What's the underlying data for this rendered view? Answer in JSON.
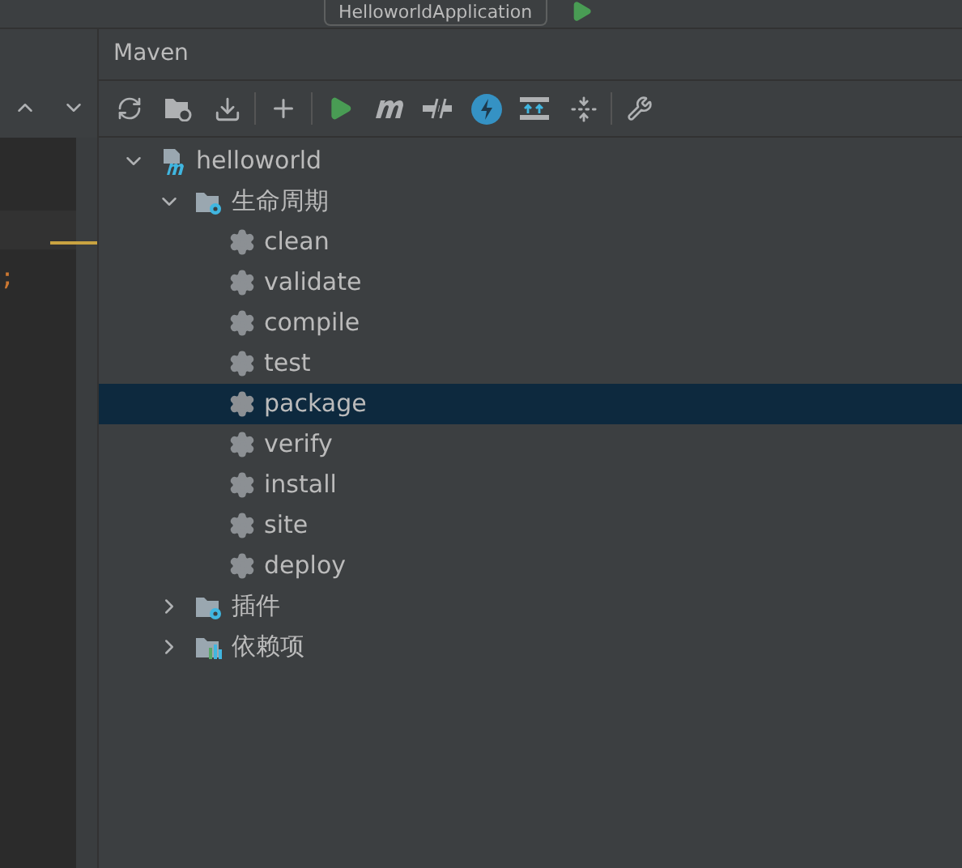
{
  "run_config": {
    "label": "HelloworldApplication"
  },
  "editor": {
    "code_fragment": ";"
  },
  "panel": {
    "title": "Maven"
  },
  "tree": [
    {
      "kind": "project",
      "label": "helloworld",
      "expanded": true,
      "selected": false,
      "children": [
        {
          "kind": "lifecycle",
          "label": "生命周期",
          "expanded": true,
          "selected": false,
          "children": [
            {
              "kind": "goal",
              "label": "clean",
              "selected": false
            },
            {
              "kind": "goal",
              "label": "validate",
              "selected": false
            },
            {
              "kind": "goal",
              "label": "compile",
              "selected": false
            },
            {
              "kind": "goal",
              "label": "test",
              "selected": false
            },
            {
              "kind": "goal",
              "label": "package",
              "selected": true
            },
            {
              "kind": "goal",
              "label": "verify",
              "selected": false
            },
            {
              "kind": "goal",
              "label": "install",
              "selected": false
            },
            {
              "kind": "goal",
              "label": "site",
              "selected": false
            },
            {
              "kind": "goal",
              "label": "deploy",
              "selected": false
            }
          ]
        },
        {
          "kind": "plugins",
          "label": "插件",
          "expanded": false,
          "selected": false
        },
        {
          "kind": "dependencies",
          "label": "依赖项",
          "expanded": false,
          "selected": false
        }
      ]
    }
  ]
}
